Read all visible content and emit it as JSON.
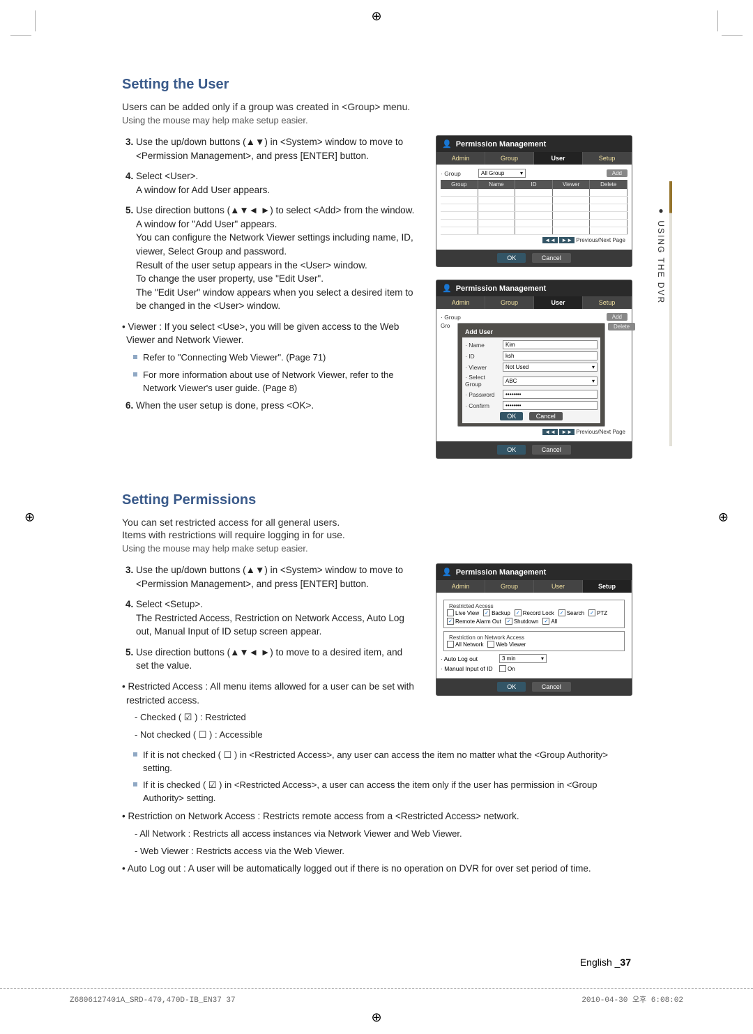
{
  "section1": {
    "title": "Setting the User",
    "intro": "Users can be added only if a group was created in <Group> menu.",
    "intro_sub": "Using the mouse may help make setup easier.",
    "step3": "Use the up/down buttons (▲▼) in <System> window to move to <Permission Management>, and press [ENTER] button.",
    "step4a": "Select <User>.",
    "step4b": "A window for Add User appears.",
    "step5a": "Use direction buttons (▲▼◄ ►) to select <Add> from the window.",
    "step5b": "A window for \"Add User\" appears.",
    "step5c": "You can configure the Network Viewer settings including name, ID, viewer, Select Group and password.",
    "step5d": "Result of the user setup appears in the <User> window.",
    "step5e": "To change the user property, use \"Edit User\".",
    "step5f": "The \"Edit User\" window appears when you select a desired item to be changed in the <User> window.",
    "viewer_bullet": "Viewer : If you select <Use>, you will be given access to the Web Viewer and Network Viewer.",
    "note1": "Refer to \"Connecting Web Viewer\". (Page 71)",
    "note2": "For more information about use of Network Viewer, refer to the Network Viewer's user guide. (Page 8)",
    "step6": "When the user setup is done, press <OK>."
  },
  "scr1": {
    "title": "Permission Management",
    "tab1": "Admin",
    "tab2": "Group",
    "tab3": "User",
    "tab4": "Setup",
    "group_lbl": "· Group",
    "group_val": "All Group",
    "add_btn": "Add",
    "col1": "Group",
    "col2": "Name",
    "col3": "ID",
    "col4": "Viewer",
    "col5": "Delete",
    "pager": "Previous/Next Page",
    "ok": "OK",
    "cancel": "Cancel"
  },
  "scr2": {
    "title": "Permission Management",
    "tab1": "Admin",
    "tab2": "Group",
    "tab3": "User",
    "tab4": "Setup",
    "group_lbl": "· Group",
    "modal_title": "Add User",
    "name_lbl": "· Name",
    "name_val": "Kim",
    "id_lbl": "· ID",
    "id_val": "ksh",
    "viewer_lbl": "· Viewer",
    "viewer_val": "Not Used",
    "selgrp_lbl": "· Select Group",
    "selgrp_val": "ABC",
    "pwd_lbl": "· Password",
    "pwd_val": "••••••••",
    "conf_lbl": "· Confirm",
    "conf_val": "••••••••",
    "ok": "OK",
    "cancel": "Cancel",
    "add_btn": "Add",
    "del_btn": "Delete",
    "pager": "Previous/Next Page"
  },
  "section2": {
    "title": "Setting Permissions",
    "intro1": "You can set restricted access for all general users.",
    "intro2": "Items with restrictions will require logging in for use.",
    "intro_sub": "Using the mouse may help make setup easier.",
    "step3": "Use the up/down buttons (▲▼) in <System> window to move to <Permission Management>, and press [ENTER] button.",
    "step4a": "Select <Setup>.",
    "step4b": "The Restricted Access, Restriction on Network Access, Auto Log out, Manual Input of ID setup screen appear.",
    "step5": "Use direction buttons (▲▼◄ ►) to move to a desired item, and set the value.",
    "bullet_ra": "Restricted Access : All menu items allowed for a user can be set with restricted access.",
    "ra_checked": "- Checked ( ☑ ) : Restricted",
    "ra_unchecked": "- Not checked ( ☐ ) : Accessible",
    "ra_note1": "If it is not checked ( ☐ ) in <Restricted Access>, any user can access the item no matter what the <Group Authority> setting.",
    "ra_note2": "If it is checked ( ☑ ) in <Restricted Access>, a user can access the item only if the user has permission in <Group Authority> setting.",
    "bullet_rna": "Restriction on Network Access : Restricts remote access from a <Restricted Access> network.",
    "rna_all": "- All Network : Restricts all access instances via Network Viewer and Web Viewer.",
    "rna_web": "- Web Viewer : Restricts access via the Web Viewer.",
    "bullet_auto": "Auto Log out : A user will be automatically logged out if there is no operation on DVR for over set period of time."
  },
  "scr3": {
    "title": "Permission Management",
    "tab1": "Admin",
    "tab2": "Group",
    "tab3": "User",
    "tab4": "Setup",
    "leg1": "Restricted Access",
    "c_live": "Live View",
    "c_backup": "Backup",
    "c_reclock": "Record Lock",
    "c_search": "Search",
    "c_ptz": "PTZ",
    "c_remote": "Remote Alarm Out",
    "c_shut": "Shutdown",
    "c_all": "All",
    "leg2": "Restriction on Network Access",
    "c_allnet": "All Network",
    "c_web": "Web Viewer",
    "auto_lbl": "· Auto Log out",
    "auto_val": "3 min",
    "manual_lbl": "· Manual Input of ID",
    "manual_val": "On",
    "ok": "OK",
    "cancel": "Cancel"
  },
  "side_tab": "●  USING THE DVR",
  "page_footer": {
    "lang": "English _",
    "num": "37"
  },
  "doc_footer_left": "Z6806127401A_SRD-470,470D-IB_EN37   37",
  "doc_footer_right": "2010-04-30   오후 6:08:02"
}
